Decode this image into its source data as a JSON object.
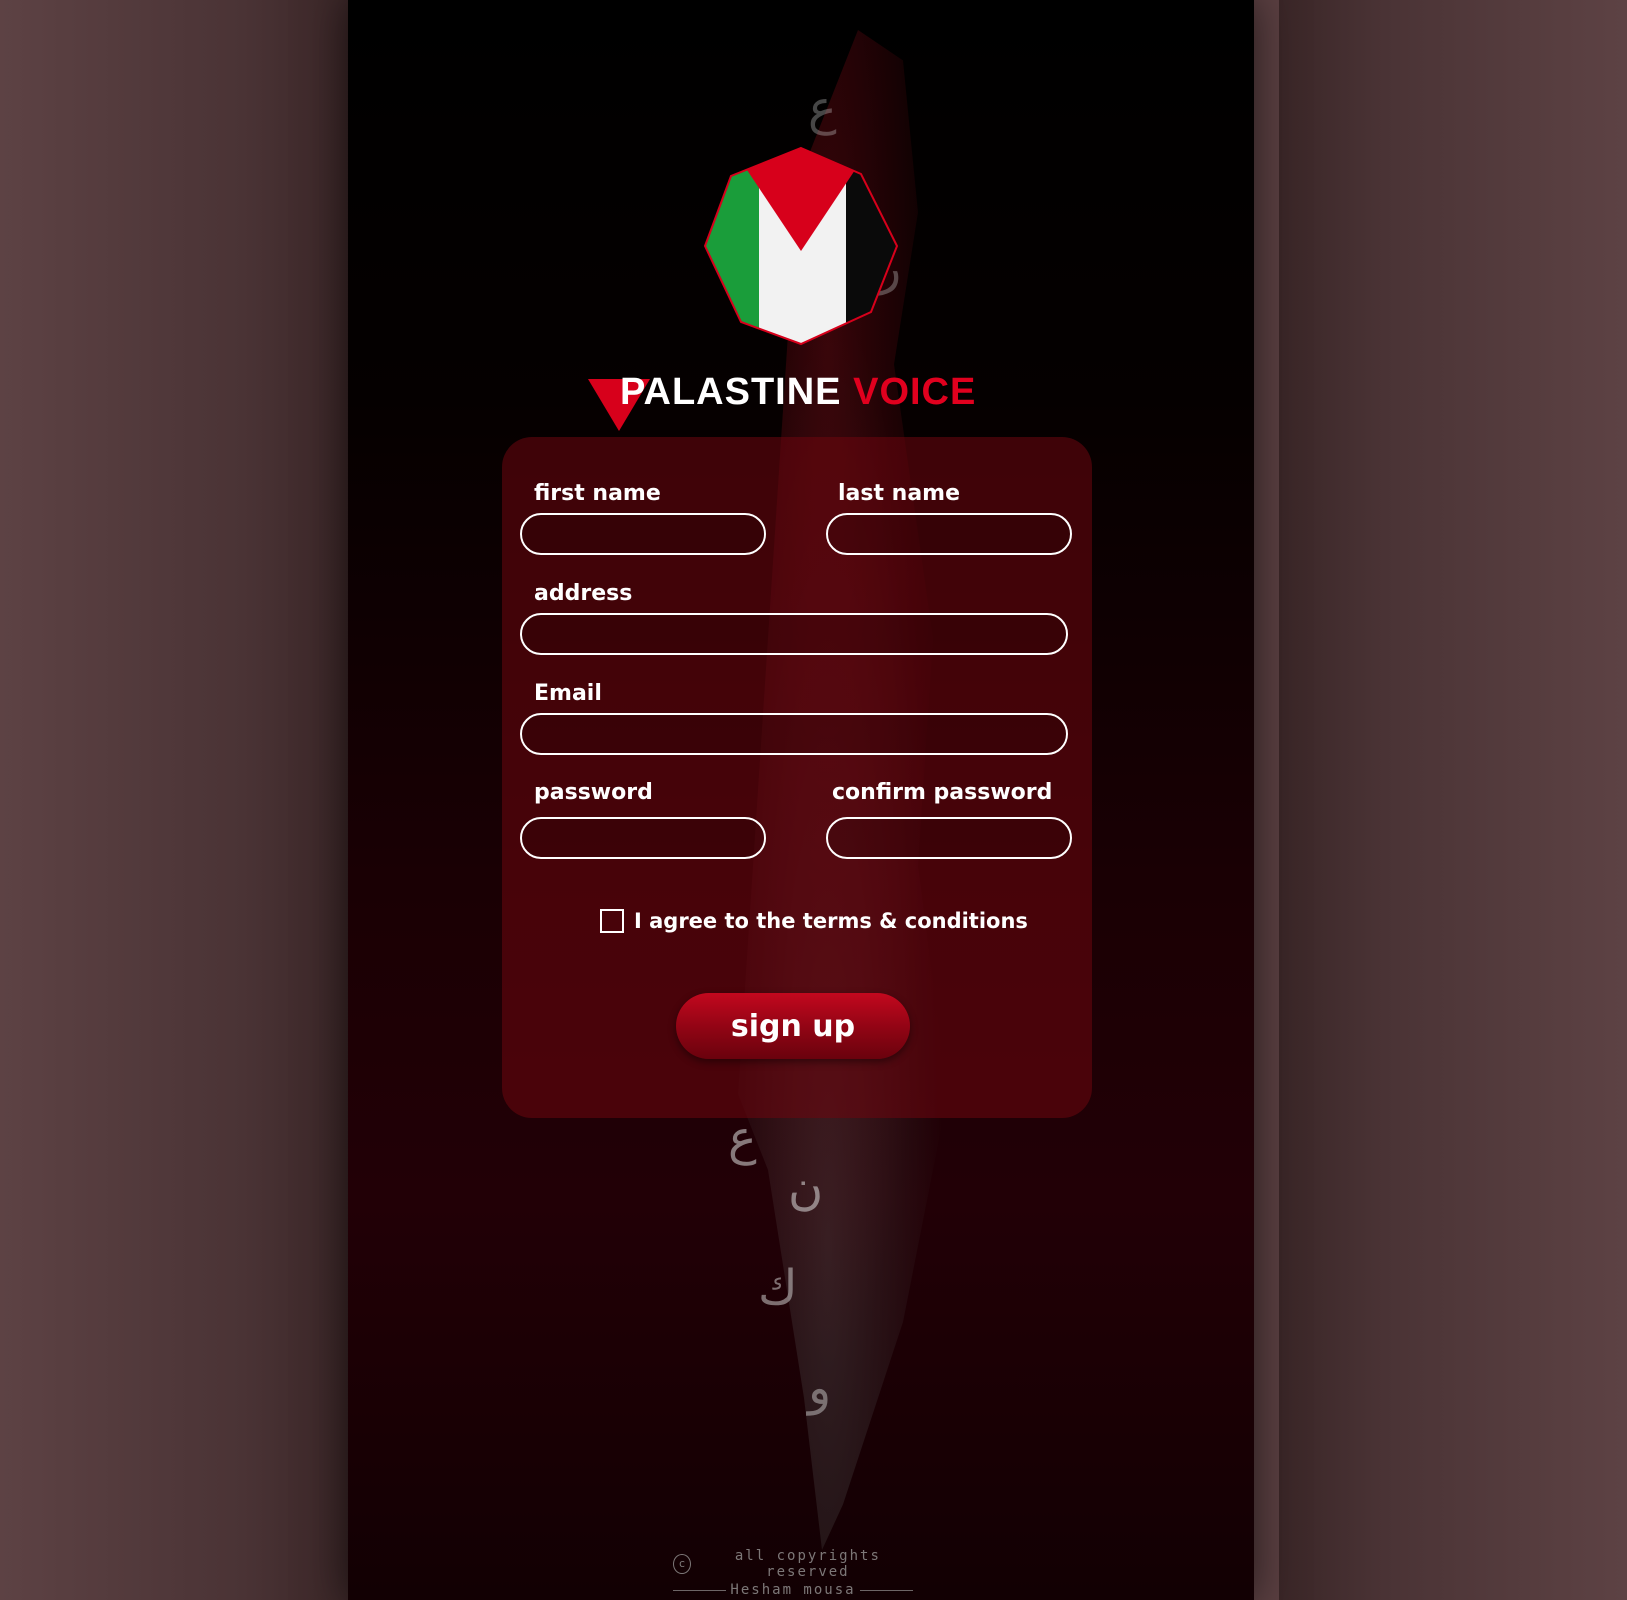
{
  "brand": {
    "word1": "PALASTINE",
    "word2": "VOICE",
    "accent_color": "#e1001e"
  },
  "logo": {
    "icon": "palestine-flag-octagon-icon",
    "colors": [
      "#d7001b",
      "#ffffff",
      "#000000",
      "#1a9d3a"
    ]
  },
  "form": {
    "first_name": {
      "label": "first name",
      "value": ""
    },
    "last_name": {
      "label": "last name",
      "value": ""
    },
    "address": {
      "label": "address",
      "value": ""
    },
    "email": {
      "label": "Email",
      "value": ""
    },
    "password": {
      "label": "password",
      "value": ""
    },
    "confirm_password": {
      "label": "confirm password",
      "value": ""
    },
    "terms": {
      "label": "I agree to the terms & conditions",
      "checked": false
    },
    "submit_label": "sign up"
  },
  "footer": {
    "copyright_icon": "copyright-icon",
    "copyright_glyph": "c",
    "copyright": "all copyrights reserved",
    "author": "Hesham mousa"
  }
}
